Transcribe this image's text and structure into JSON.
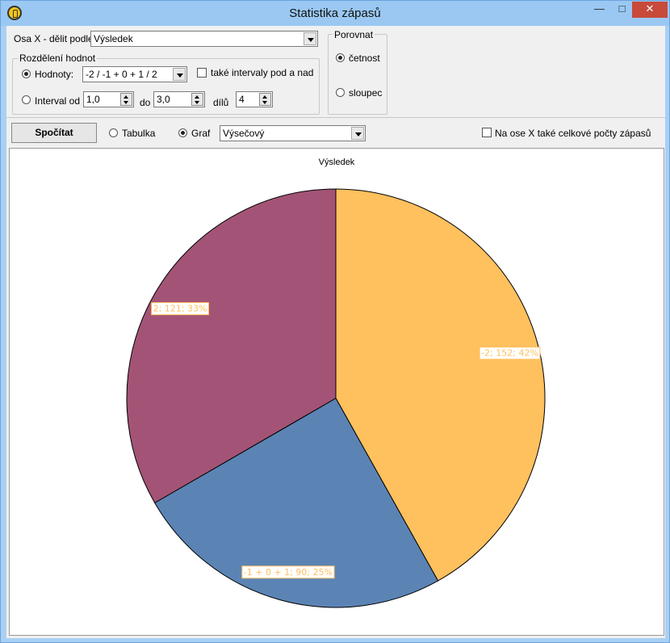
{
  "window": {
    "title": "Statistika zápasů"
  },
  "controls": {
    "osa_label": "Osa X - dělit podle",
    "osa_value": "Výsledek",
    "rozdeleni_title": "Rozdělení hodnot",
    "hodnoty_label": "Hodnoty:",
    "hodnoty_value": "-2 / -1 + 0 + 1 / 2",
    "take_intervaly_label": "také intervaly pod a nad",
    "interval_label": "Interval od",
    "interval_from": "1,0",
    "do_label": "do",
    "interval_to": "3,0",
    "dilu_label": "dílů",
    "dilu_value": "4",
    "porovnat_title": "Porovnat",
    "cetnost_label": "četnost",
    "sloupec_label": "sloupec",
    "spocitat_label": "Spočítat",
    "tabulka_label": "Tabulka",
    "graf_label": "Graf",
    "graf_type": "Výsečový",
    "na_ose_label": "Na ose X také celkové počty zápasů"
  },
  "chart_data": {
    "type": "pie",
    "title": "Výsledek",
    "slices": [
      {
        "label": "-2; 152; 42%",
        "category": "-2",
        "value": 152,
        "percent": 42,
        "color": "#FFC05E"
      },
      {
        "label": "-1 + 0 + 1; 90; 25%",
        "category": "-1 + 0 + 1",
        "value": 90,
        "percent": 25,
        "color": "#5B84B5"
      },
      {
        "label": "2; 121; 33%",
        "category": "2",
        "value": 121,
        "percent": 33,
        "color": "#A35476"
      }
    ],
    "label_color": "#FFC05E",
    "start": "12 o'clock",
    "direction": "clockwise"
  }
}
